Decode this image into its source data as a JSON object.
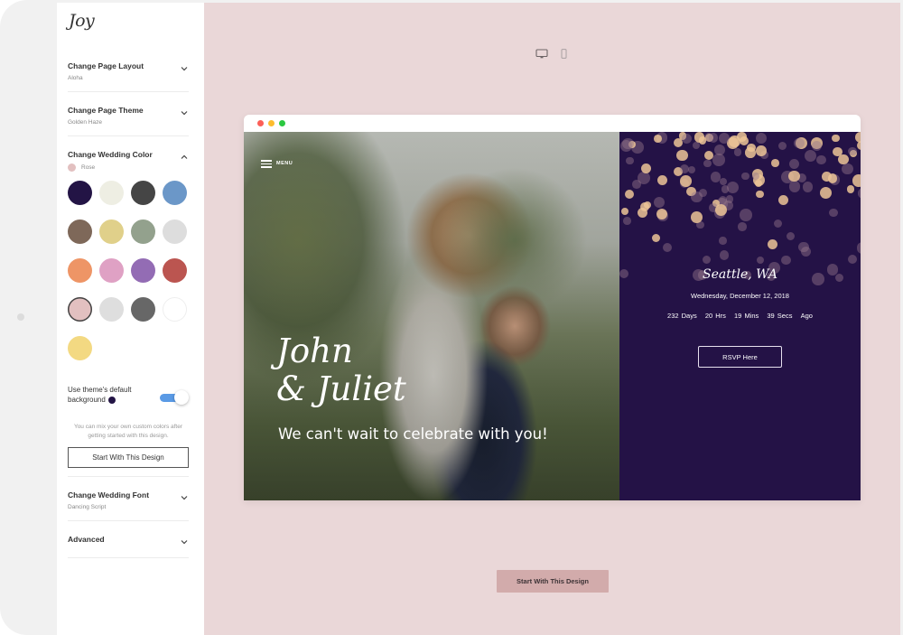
{
  "sidebar": {
    "logo": "Joy",
    "sections": [
      {
        "title": "Change Page Layout",
        "value": "Aloha",
        "expanded": false
      },
      {
        "title": "Change Page Theme",
        "value": "Golden Haze",
        "expanded": false
      },
      {
        "title": "Change Wedding Color",
        "value": "Rose",
        "expanded": true
      },
      {
        "title": "Change Wedding Font",
        "value": "Dancing Script",
        "expanded": false
      },
      {
        "title": "Advanced",
        "value": "",
        "expanded": false
      }
    ],
    "color_swatches": [
      {
        "name": "midnight",
        "hex": "#231445"
      },
      {
        "name": "ivory",
        "hex": "#eeeee3"
      },
      {
        "name": "charcoal",
        "hex": "#454545"
      },
      {
        "name": "blue",
        "hex": "#6b97c8"
      },
      {
        "name": "brown",
        "hex": "#7e6859"
      },
      {
        "name": "gold",
        "hex": "#e0d08a"
      },
      {
        "name": "sage",
        "hex": "#93a18d"
      },
      {
        "name": "silver",
        "hex": "#dddddd"
      },
      {
        "name": "orange",
        "hex": "#ee9566"
      },
      {
        "name": "pink",
        "hex": "#dfa1c4"
      },
      {
        "name": "purple",
        "hex": "#936cb4"
      },
      {
        "name": "red",
        "hex": "#bb5550"
      },
      {
        "name": "rose",
        "hex": "#e2c0c0",
        "selected": true
      },
      {
        "name": "light-grey",
        "hex": "#dedede"
      },
      {
        "name": "grey",
        "hex": "#676767"
      },
      {
        "name": "white",
        "hex": "#ffffff"
      },
      {
        "name": "yellow",
        "hex": "#f3d982"
      }
    ],
    "toggle": {
      "label": "Use theme's default background",
      "on": true,
      "dot_color": "#231445"
    },
    "hint": "You can mix your own custom colors after getting started with this design.",
    "start_button": "Start With This Design"
  },
  "preview": {
    "view_modes": [
      "desktop-icon",
      "mobile-icon"
    ],
    "active_view": "desktop",
    "site": {
      "menu_label": "MENU",
      "names_line1": "John",
      "names_line2": "& Juliet",
      "tagline": "We can't wait to celebrate with you!",
      "location": "Seattle, WA",
      "date": "Wednesday, December 12, 2018",
      "countdown": {
        "days": "232 Days",
        "hours": "20 Hrs",
        "mins": "19 Mins",
        "secs": "39 Secs",
        "suffix": "Ago"
      },
      "rsvp_label": "RSVP Here"
    },
    "cta_button": "Start With This Design"
  },
  "colors": {
    "canvas_bg": "#ead7d8",
    "theme_bg": "#241246",
    "cta_bg": "#d2abab",
    "toggle_on": "#5a9ae5"
  }
}
